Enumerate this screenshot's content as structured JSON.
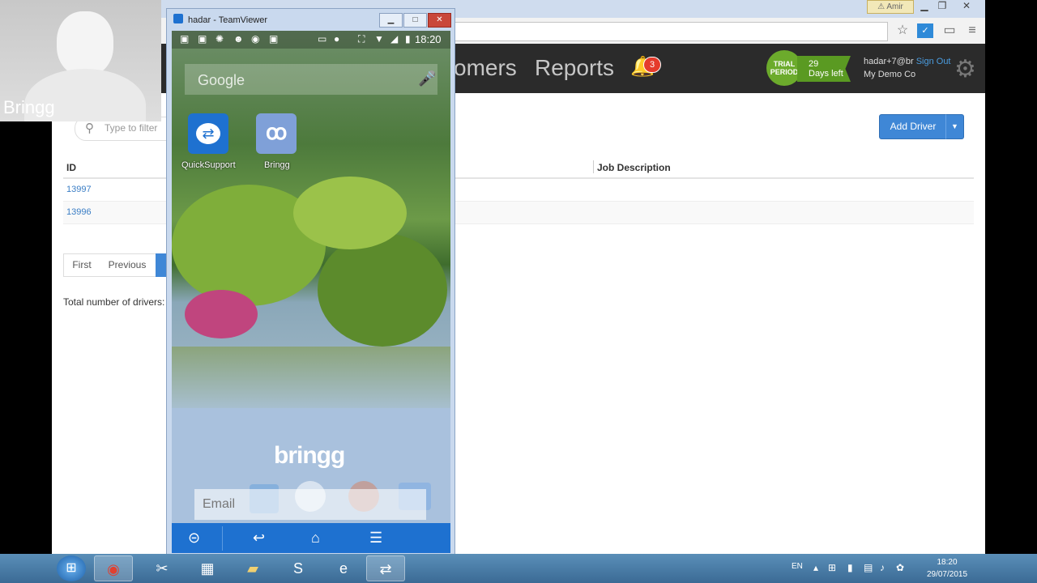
{
  "browser": {
    "user_badge": "Amir",
    "nav": {
      "customers_partial": "omers",
      "reports": "Reports",
      "notification_count": "3"
    },
    "trial": {
      "line1": "TRIAL",
      "line2": "PERIOD",
      "days": "29",
      "days_label": "Days left"
    },
    "user": {
      "email": "hadar+7@br",
      "sign_out": "Sign Out",
      "company": "My Demo Co"
    },
    "filter_placeholder": "Type to filter",
    "add_driver": "Add Driver",
    "table": {
      "headers": {
        "id": "ID",
        "job_description": "Job Description"
      },
      "rows": [
        {
          "id": "13997"
        },
        {
          "id": "13996"
        }
      ]
    },
    "pagination": {
      "first": "First",
      "previous": "Previous"
    },
    "total_label": "Total number of drivers:"
  },
  "webcam": {
    "label": "Bringg"
  },
  "teamviewer": {
    "title": "hadar - TeamViewer",
    "phone": {
      "clock": "18:20",
      "search_label": "Google",
      "apps": [
        {
          "label": "QuickSupport"
        },
        {
          "label": "Bringg"
        }
      ],
      "overlay_logo": "bringg",
      "email_placeholder": "Email"
    }
  },
  "taskbar": {
    "lang": "EN",
    "time": "18:20",
    "date": "29/07/2015"
  }
}
